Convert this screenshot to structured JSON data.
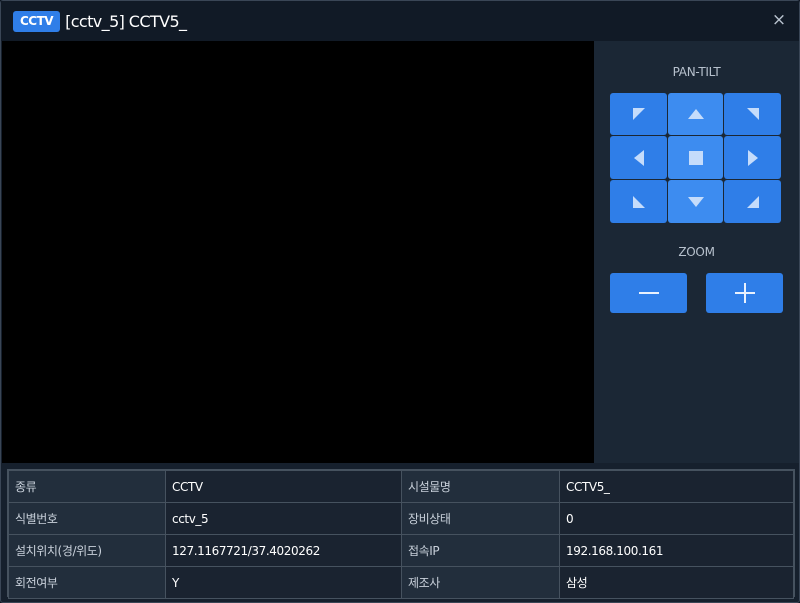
{
  "window": {
    "badge": "CCTV",
    "title": "[cctv_5] CCTV5_",
    "close_label": "×"
  },
  "controls": {
    "pan_tilt_label": "PAN-TILT",
    "zoom_label": "ZOOM",
    "accent_color": "#2f7ee8"
  },
  "info": {
    "rows": [
      {
        "k1": "종류",
        "v1": "CCTV",
        "k2": "시설물명",
        "v2": "CCTV5_"
      },
      {
        "k1": "식별번호",
        "v1": "cctv_5",
        "k2": "장비상태",
        "v2": "0"
      },
      {
        "k1": "설치위치(경/위도)",
        "v1": "127.1167721/37.4020262",
        "k2": "접속IP",
        "v2": "192.168.100.161"
      },
      {
        "k1": "회전여부",
        "v1": "Y",
        "k2": "제조사",
        "v2": "삼성"
      }
    ]
  }
}
